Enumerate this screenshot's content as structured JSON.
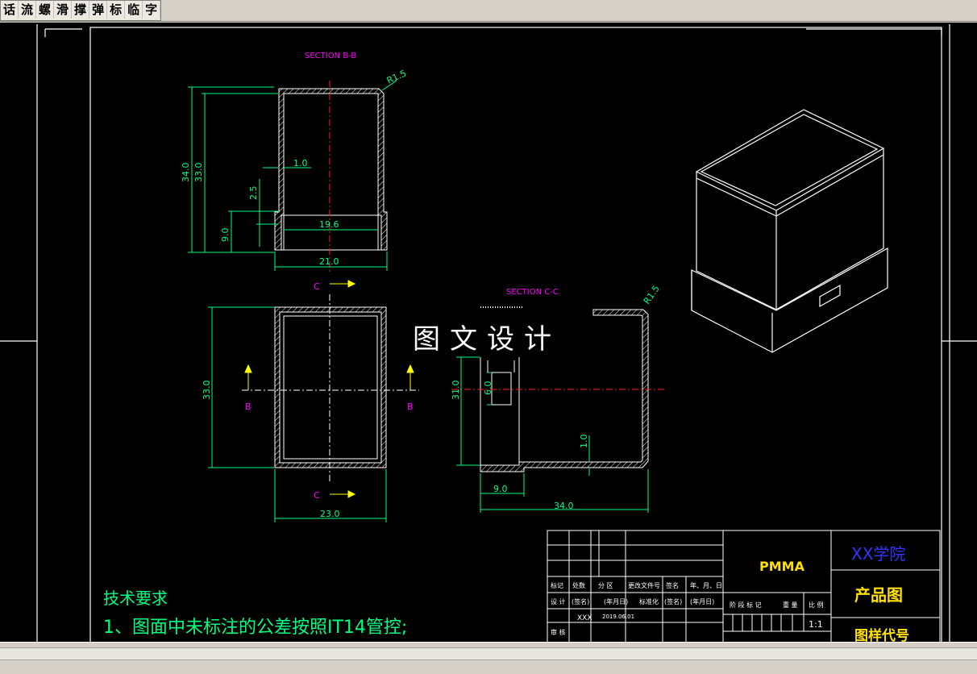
{
  "toolbar": {
    "buttons": [
      "话",
      "流",
      "螺",
      "滑",
      "撑",
      "弹",
      "标",
      "临",
      "字"
    ]
  },
  "drawing": {
    "section_bb": "SECTION B-B",
    "section_cc": "SECTION C-C",
    "radius_label": "R1.5",
    "dims_bb": {
      "h_outer": "34.0",
      "h_inner": "33.0",
      "wall": "1.0",
      "step": "2.5",
      "base_h": "9.0",
      "inner_w": "19.6",
      "outer_w": "21.0"
    },
    "dims_top": {
      "height": "33.0",
      "width": "23.0",
      "cut_c": "C",
      "cut_b": "B"
    },
    "dims_cc": {
      "height": "31.0",
      "slot": "6.0",
      "wall": "1.0",
      "base": "9.0",
      "length": "34.0"
    },
    "watermark": "图文设计",
    "tech_title": "技术要求",
    "tech_item1": "1、图面中未标注的公差按照IT14管控;"
  },
  "title_block": {
    "material": "PMMA",
    "school": "XX学院",
    "drawing_type": "产品图",
    "drawing_code": "图样代号",
    "scale": "1:1",
    "row_labels": [
      "标记",
      "处数",
      "分 区",
      "更改文件号",
      "签名",
      "年、月、日"
    ],
    "design_label": "设 计",
    "sign_label": "(签名)",
    "date_label": "(年月日)",
    "std_label": "标准化",
    "review_label": "审 核",
    "designer": "XXX",
    "date": "2019.06.01",
    "stage_labels": [
      "阶 段 标 记",
      "重 量",
      "比 例"
    ]
  },
  "colors": {
    "canvas": "#000000",
    "white": "#ffffff",
    "dim": "#00ff80",
    "magenta": "#ff00ff",
    "red": "#ff0000",
    "yellow": "#ffff00",
    "blue": "#3333ff",
    "gold": "#ffe000"
  }
}
